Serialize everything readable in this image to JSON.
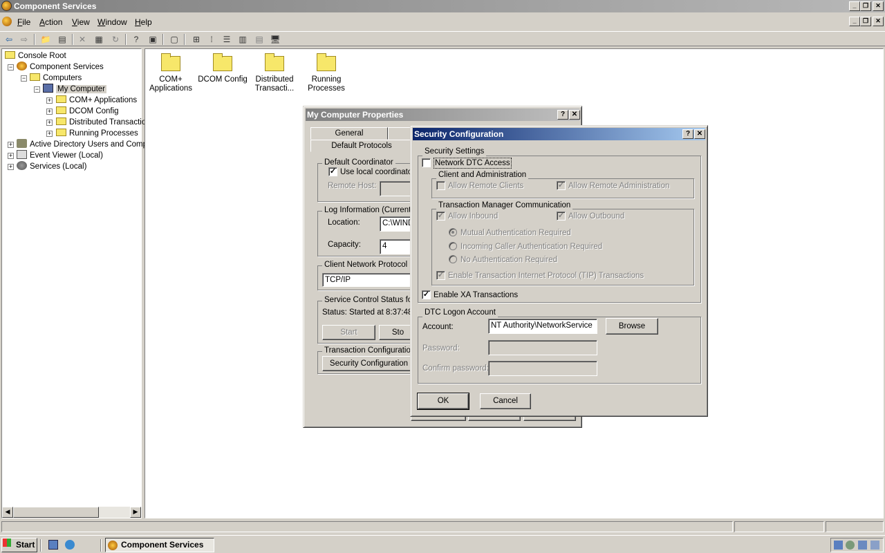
{
  "app": {
    "title": "Component Services"
  },
  "menu": [
    {
      "label": "File",
      "key": "F",
      "rest": "ile"
    },
    {
      "label": "Action",
      "key": "A",
      "rest": "ction"
    },
    {
      "label": "View",
      "key": "V",
      "rest": "iew"
    },
    {
      "label": "Window",
      "key": "W",
      "rest": "indow"
    },
    {
      "label": "Help",
      "key": "H",
      "rest": "elp"
    }
  ],
  "tree": {
    "items": [
      {
        "label": "Console Root"
      },
      {
        "label": "Component Services"
      },
      {
        "label": "Computers"
      },
      {
        "label": "My Computer"
      },
      {
        "label": "COM+ Applications"
      },
      {
        "label": "DCOM Config"
      },
      {
        "label": "Distributed Transactio"
      },
      {
        "label": "Running Processes"
      },
      {
        "label": "Active Directory Users and Comp"
      },
      {
        "label": "Event Viewer (Local)"
      },
      {
        "label": "Services (Local)"
      }
    ]
  },
  "content": {
    "folders": [
      {
        "label1": "COM+",
        "label2": "Applications"
      },
      {
        "label1": "DCOM Config",
        "label2": ""
      },
      {
        "label1": "Distributed",
        "label2": "Transacti..."
      },
      {
        "label1": "Running",
        "label2": "Processes"
      }
    ]
  },
  "props": {
    "title": "My Computer Properties",
    "tab_general": "General",
    "tab_default_protocols": "Default Protocols",
    "default_coordinator": "Default Coordinator",
    "use_local": "Use local coordinator",
    "remote_host": "Remote Host:",
    "log_info": "Log Information (Currently",
    "location": "Location:",
    "location_value": "C:\\WIND",
    "capacity": "Capacity:",
    "capacity_value": "4",
    "client_protocol": "Client Network Protocol Co",
    "protocol_value": "TCP/IP",
    "service_status": "Service Control Status for",
    "status_text": "Status: Started at 8:37:48 A",
    "start": "Start",
    "stop": "Sto",
    "transaction_config": "Transaction Configuration",
    "security_config": "Security Configuration"
  },
  "security": {
    "title": "Security Configuration",
    "security_settings": "Security Settings",
    "network_dtc": "Network DTC Access",
    "client_admin": "Client and Administration",
    "allow_remote_clients": "Allow Remote Clients",
    "allow_remote_admin": "Allow Remote Administration",
    "tm_comm": "Transaction Manager Communication",
    "allow_inbound": "Allow Inbound",
    "allow_outbound": "Allow Outbound",
    "mutual_auth": "Mutual Authentication Required",
    "incoming_auth": "Incoming Caller Authentication Required",
    "no_auth": "No Authentication Required",
    "enable_tip": "Enable Transaction Internet Protocol (TIP) Transactions",
    "enable_xa": "Enable XA Transactions",
    "dtc_logon": "DTC Logon Account",
    "account": "Account:",
    "account_value": "NT Authority\\NetworkService",
    "browse": "Browse",
    "password": "Password:",
    "confirm_password": "Confirm password:",
    "ok": "OK",
    "cancel": "Cancel",
    "check_mark": "✓"
  },
  "taskbar": {
    "start": "Start",
    "task": "Component Services"
  },
  "window_buttons": {
    "minimize": "_",
    "maximize": "❐",
    "close": "✕",
    "help": "?"
  }
}
